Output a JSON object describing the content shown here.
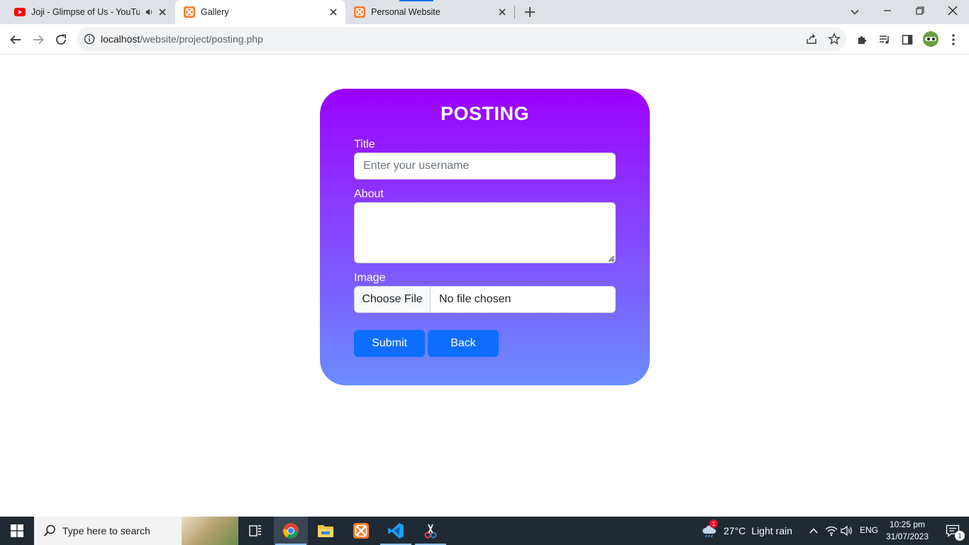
{
  "browser": {
    "tabs": [
      {
        "title": "Joji - Glimpse of Us - YouTube",
        "favicon": "youtube-icon",
        "audio": "speaker-icon"
      },
      {
        "title": "Gallery",
        "favicon": "xampp-icon",
        "active": true
      },
      {
        "title": "Personal Website",
        "favicon": "xampp-icon"
      }
    ],
    "address_bar": {
      "host": "localhost",
      "path": "/website/project/posting.php"
    },
    "colors": {
      "tabstrip": "#dee1e6",
      "active_tab": "#ffffff"
    }
  },
  "form": {
    "heading": "POSTING",
    "title_label": "Title",
    "title_placeholder": "Enter your username",
    "title_value": "",
    "about_label": "About",
    "about_value": "",
    "image_label": "Image",
    "file_button_label": "Choose File",
    "file_status": "No file chosen",
    "submit_label": "Submit",
    "back_label": "Back",
    "colors": {
      "gradient_top": "#9b00ff",
      "gradient_bottom": "#6b8dff",
      "button": "#0d6efd"
    }
  },
  "taskbar": {
    "search_placeholder": "Type here to search",
    "apps": [
      "task-view-icon",
      "chrome-icon",
      "file-explorer-icon",
      "xampp-icon",
      "vscode-icon",
      "snipping-tool-icon"
    ],
    "weather_temp": "27°C",
    "weather_condition": "Light rain",
    "weather_badge": "1",
    "language": "ENG",
    "time": "10:25 pm",
    "date": "31/07/2023",
    "notification_count": "1"
  }
}
